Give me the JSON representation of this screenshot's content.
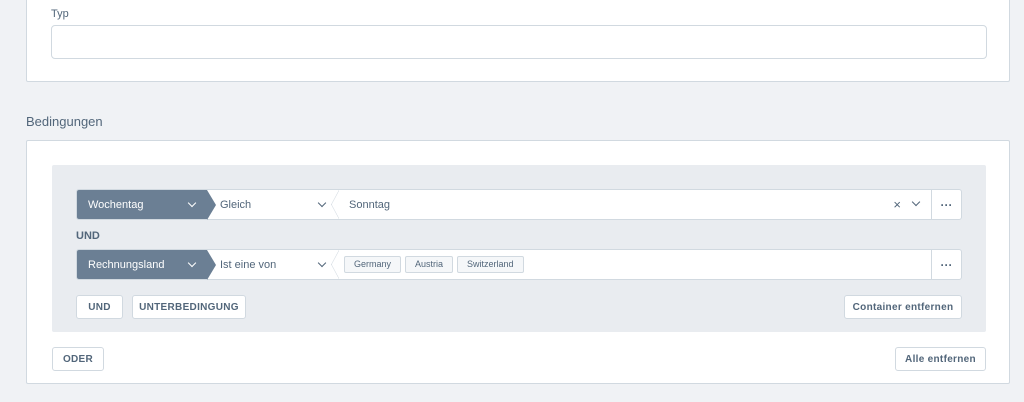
{
  "top_card": {
    "type_label": "Typ",
    "type_value": ""
  },
  "conditions": {
    "section_title": "Bedingungen",
    "rows": [
      {
        "field": "Wochentag",
        "operator": "Gleich",
        "value": "Sonntag",
        "clear_symbol": "×",
        "more_symbol": "···"
      },
      {
        "field": "Rechnungsland",
        "operator": "Ist eine von",
        "tags": [
          "Germany",
          "Austria",
          "Switzerland"
        ],
        "more_symbol": "···"
      }
    ],
    "connector_label": "UND",
    "container_buttons": {
      "and_label": "UND",
      "subcondition_label": "UNTERBEDINGUNG",
      "remove_container_label": "Container entfernen"
    },
    "footer_buttons": {
      "or_label": "ODER",
      "remove_all_label": "Alle entfernen"
    }
  },
  "colors": {
    "field_select_bg": "#6b7f94",
    "container_bg": "#e9ecf0",
    "page_bg": "#f0f2f5",
    "border": "#d1d9e0",
    "text": "#52667a"
  }
}
